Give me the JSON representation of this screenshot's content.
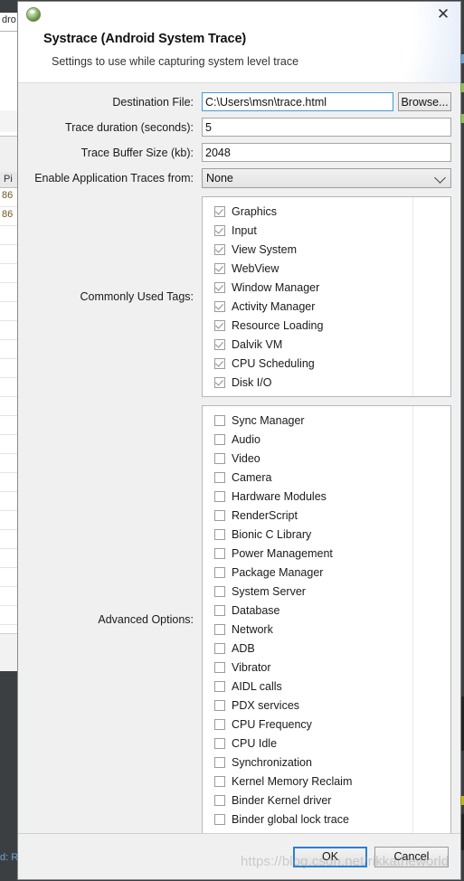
{
  "background": {
    "tab_label": "dro",
    "table_header": "Pi",
    "rows": [
      "86",
      "86"
    ],
    "console_text": "d: Ru"
  },
  "dialog": {
    "icon_name": "systrace-sphere-icon",
    "close_label": "✕",
    "title": "Systrace (Android System Trace)",
    "subtitle": "Settings to use while capturing system level trace",
    "fields": [
      {
        "label": "Destination File:",
        "value": "C:\\Users\\msn\\trace.html",
        "placeholder": "",
        "focused": true,
        "button": "Browse..."
      },
      {
        "label": "Trace duration (seconds):",
        "value": "5",
        "placeholder": "",
        "focused": false
      },
      {
        "label": "Trace Buffer Size (kb):",
        "value": "2048",
        "placeholder": "",
        "focused": false
      }
    ],
    "app_traces": {
      "label": "Enable Application Traces from:",
      "selected": "None",
      "options": [
        "None"
      ]
    },
    "common_tags": {
      "label": "Commonly Used Tags:",
      "items": [
        {
          "label": "Graphics",
          "checked": true
        },
        {
          "label": "Input",
          "checked": true
        },
        {
          "label": "View System",
          "checked": true
        },
        {
          "label": "WebView",
          "checked": true
        },
        {
          "label": "Window Manager",
          "checked": true
        },
        {
          "label": "Activity Manager",
          "checked": true
        },
        {
          "label": "Resource Loading",
          "checked": true
        },
        {
          "label": "Dalvik VM",
          "checked": true
        },
        {
          "label": "CPU Scheduling",
          "checked": true
        },
        {
          "label": "Disk I/O",
          "checked": true
        }
      ]
    },
    "advanced_options": {
      "label": "Advanced Options:",
      "items": [
        {
          "label": "Sync Manager",
          "checked": false
        },
        {
          "label": "Audio",
          "checked": false
        },
        {
          "label": "Video",
          "checked": false
        },
        {
          "label": "Camera",
          "checked": false
        },
        {
          "label": "Hardware Modules",
          "checked": false
        },
        {
          "label": "RenderScript",
          "checked": false
        },
        {
          "label": "Bionic C Library",
          "checked": false
        },
        {
          "label": "Power Management",
          "checked": false
        },
        {
          "label": "Package Manager",
          "checked": false
        },
        {
          "label": "System Server",
          "checked": false
        },
        {
          "label": "Database",
          "checked": false
        },
        {
          "label": "Network",
          "checked": false
        },
        {
          "label": "ADB",
          "checked": false
        },
        {
          "label": "Vibrator",
          "checked": false
        },
        {
          "label": "AIDL calls",
          "checked": false
        },
        {
          "label": "PDX services",
          "checked": false
        },
        {
          "label": "CPU Frequency",
          "checked": false
        },
        {
          "label": "CPU Idle",
          "checked": false
        },
        {
          "label": "Synchronization",
          "checked": false
        },
        {
          "label": "Kernel Memory Reclaim",
          "checked": false
        },
        {
          "label": "Binder Kernel driver",
          "checked": false
        },
        {
          "label": "Binder global lock trace",
          "checked": false
        }
      ]
    },
    "footer": {
      "ok_label": "OK",
      "cancel_label": "Cancel"
    }
  },
  "watermark": "https://blog.csdn.net/rikkatheworld",
  "colors": {
    "accent": "#2a7fd4",
    "focus_border": "#3e9bdd",
    "dialog_bg": "#f0f0f0",
    "header_bg": "#ffffff",
    "console_bg": "#3c3f41"
  }
}
